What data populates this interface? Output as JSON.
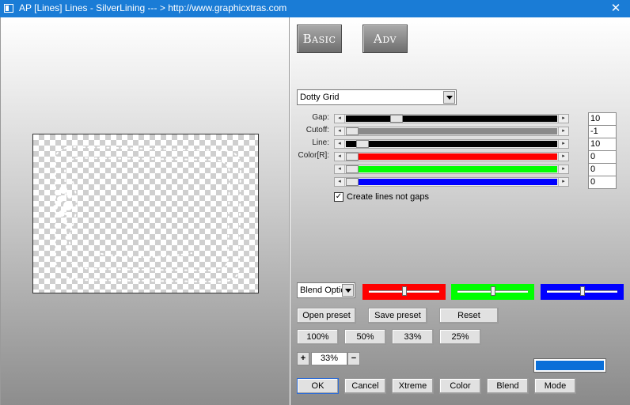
{
  "window": {
    "title": "AP [Lines]  Lines - SilverLining     --- > http://www.graphicxtras.com",
    "close_glyph": "✕"
  },
  "tabs": {
    "basic": "Basic",
    "adv": "Adv"
  },
  "preset": {
    "selected": "Dotty Grid"
  },
  "sliders": [
    {
      "label": "Gap:",
      "value": "10",
      "fraction": 0.22,
      "fill": "#000000"
    },
    {
      "label": "Cutoff:",
      "value": "-1",
      "fraction": 0.0,
      "fill": "#8a8a8a"
    },
    {
      "label": "Line:",
      "value": "10",
      "fraction": 0.05,
      "fill": "#000000"
    },
    {
      "label": "Color[R]:",
      "value": "0",
      "fraction": 0.0,
      "fill": "#ff0000"
    },
    {
      "label": "",
      "value": "0",
      "fraction": 0.0,
      "fill": "#00ff00"
    },
    {
      "label": "",
      "value": "0",
      "fraction": 0.0,
      "fill": "#0000ff"
    }
  ],
  "checkbox": {
    "label": "Create lines not gaps",
    "checked": true,
    "mark": "✓"
  },
  "blend": {
    "selected": "Blend Options"
  },
  "channel_bars": [
    {
      "color": "#ff0000",
      "fraction": 0.5
    },
    {
      "color": "#00ff00",
      "fraction": 0.5
    },
    {
      "color": "#0000ff",
      "fraction": 0.5
    }
  ],
  "buttons": {
    "open_preset": "Open preset",
    "save_preset": "Save preset",
    "reset": "Reset",
    "zoom_100": "100%",
    "zoom_50": "50%",
    "zoom_33": "33%",
    "zoom_25": "25%",
    "plus": "+",
    "minus": "−",
    "ok": "OK",
    "cancel": "Cancel",
    "xtreme": "Xtreme",
    "color": "Color",
    "blend": "Blend",
    "mode": "Mode"
  },
  "zoom": {
    "value": "33%"
  },
  "swatch": {
    "color": "#0a6fd8"
  }
}
